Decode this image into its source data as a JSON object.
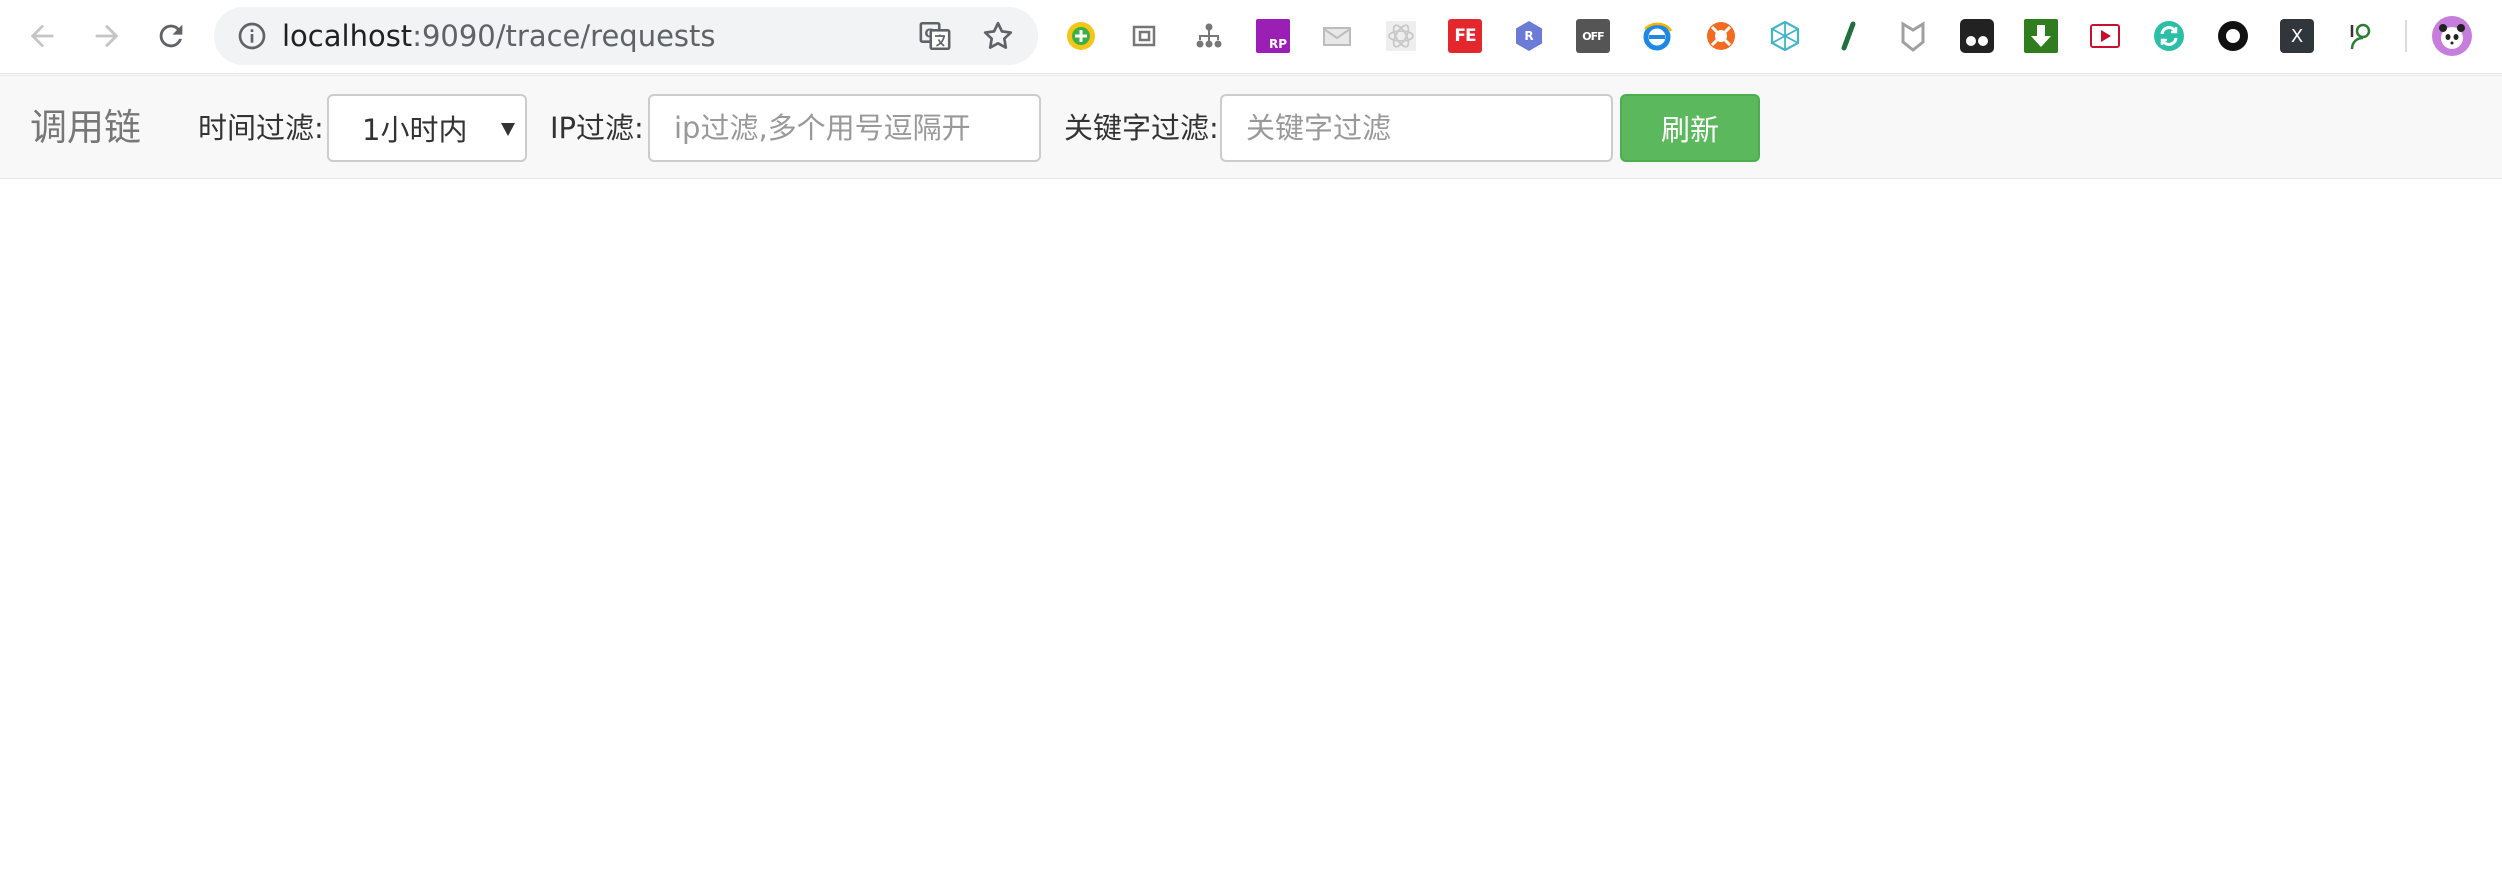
{
  "browser": {
    "url_host": "localhost",
    "url_rest": ":9090/trace/requests",
    "extensions": [
      "360-safe-icon",
      "web-capture-icon",
      "sitemap-icon",
      "axure-rp-icon",
      "mail-icon",
      "react-devtools-icon",
      "fehelper-icon",
      "r-extension-icon",
      "off-toggle-icon",
      "ie-tab-icon",
      "lifebuoy-icon",
      "network-icon",
      "slash-icon",
      "shield-icon",
      "tampermonkey-icon",
      "download-icon",
      "youtube-icon",
      "refresh-sync-icon",
      "circle-record-icon",
      "x-icon",
      "user-icon"
    ],
    "ext_labels": {
      "fehelper": "FE",
      "rp": "RP",
      "r": "R",
      "off": "OFF",
      "x": "X"
    }
  },
  "appbar": {
    "brand": "调用链",
    "time_filter_label": "时间过滤:",
    "time_filter_value": "1小时内",
    "ip_filter_label": "IP过滤:",
    "ip_filter_placeholder": "ip过滤,多个用号逗隔开",
    "keyword_filter_label": "关键字过滤:",
    "keyword_filter_placeholder": "关键字过滤",
    "refresh_button": "刷新"
  },
  "colors": {
    "success": "#5cb85c",
    "navbar_bg": "#f8f8f8",
    "brand_text": "#777777"
  }
}
